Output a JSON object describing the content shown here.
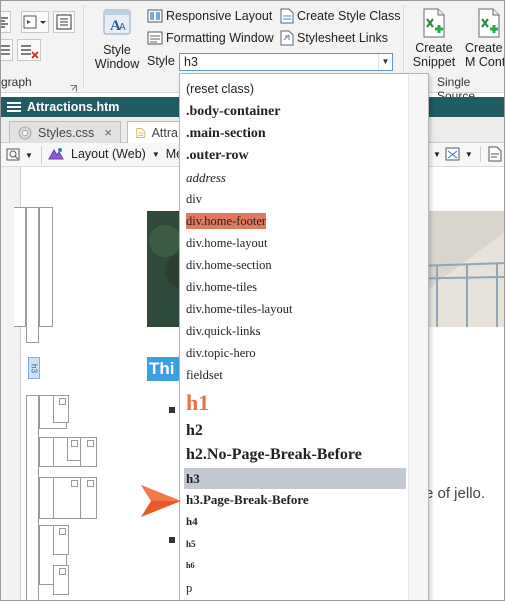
{
  "ribbon": {
    "paragraph_group_label": "graph",
    "style_window_label": "Style Window",
    "responsive_layout_label": "Responsive Layout",
    "formatting_window_label": "Formatting Window",
    "create_style_class_label": "Create Style Class",
    "stylesheet_links_label": "Stylesheet Links",
    "style_label": "Style",
    "style_value": "h3",
    "create_snippet_label": "Create Snippet",
    "create_more_label": "Create M Conte",
    "single_source_label": "Single Source"
  },
  "document": {
    "title": "Attractions.htm"
  },
  "tabs": [
    {
      "label": "Styles.css",
      "close": "×"
    },
    {
      "label": "Attra"
    }
  ],
  "toolbar": {
    "layout_label": "Layout (Web)",
    "me_label": "Me"
  },
  "editor": {
    "structure_tag": "h3",
    "heading_text": "Thi",
    "tail_text": "e of jello."
  },
  "style_list": {
    "items": [
      {
        "label": "(reset class)"
      },
      {
        "label": ".body-container"
      },
      {
        "label": ".main-section"
      },
      {
        "label": ".outer-row"
      },
      {
        "label": "address"
      },
      {
        "label": "div"
      },
      {
        "label": "div.home-footer"
      },
      {
        "label": "div.home-layout"
      },
      {
        "label": "div.home-section"
      },
      {
        "label": "div.home-tiles"
      },
      {
        "label": "div.home-tiles-layout"
      },
      {
        "label": "div.quick-links"
      },
      {
        "label": "div.topic-hero"
      },
      {
        "label": "fieldset"
      },
      {
        "label": "h1"
      },
      {
        "label": "h2"
      },
      {
        "label": "h2.No-Page-Break-Before"
      },
      {
        "label": "h3",
        "selected": true
      },
      {
        "label": "h3.Page-Break-Before"
      },
      {
        "label": "h4"
      },
      {
        "label": "h5"
      },
      {
        "label": "h6"
      },
      {
        "label": "p"
      }
    ]
  },
  "colors": {
    "title_bar": "#1f5c63",
    "h1_color": "#e8704a",
    "footer_highlight": "#e07a5f",
    "selected_row": "#c3c9d1",
    "callout_arrow": "#e85a2a",
    "heading_highlight": "#3b9fe0"
  }
}
